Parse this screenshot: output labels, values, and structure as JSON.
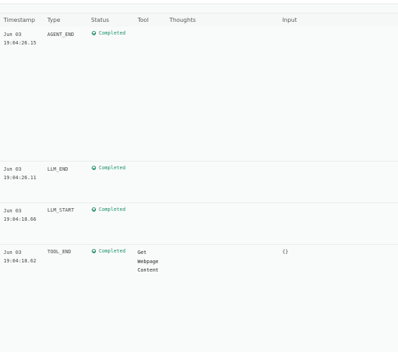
{
  "headers": {
    "timestamp": "Timestamp",
    "type": "Type",
    "status": "Status",
    "tool": "Tool",
    "thoughts": "Thoughts",
    "input": "Input"
  },
  "rows": [
    {
      "date": "Jun 03",
      "time": "19:04:26.15",
      "type": "AGENT_END",
      "status": "Completed",
      "tool": [],
      "input": ""
    },
    {
      "date": "Jun 03",
      "time": "19:04:26.11",
      "type": "LLM_END",
      "status": "Completed",
      "tool": [],
      "input": ""
    },
    {
      "date": "Jun 03",
      "time": "19:04:18.66",
      "type": "LLM_START",
      "status": "Completed",
      "tool": [],
      "input": ""
    },
    {
      "date": "Jun 03",
      "time": "19:04:18.62",
      "type": "TOOL_END",
      "status": "Completed",
      "tool": [
        "Get",
        "Webpage",
        "Content"
      ],
      "input": "{}"
    }
  ],
  "colors": {
    "status_completed": "#1f8b66",
    "background": "#f8fafa"
  }
}
